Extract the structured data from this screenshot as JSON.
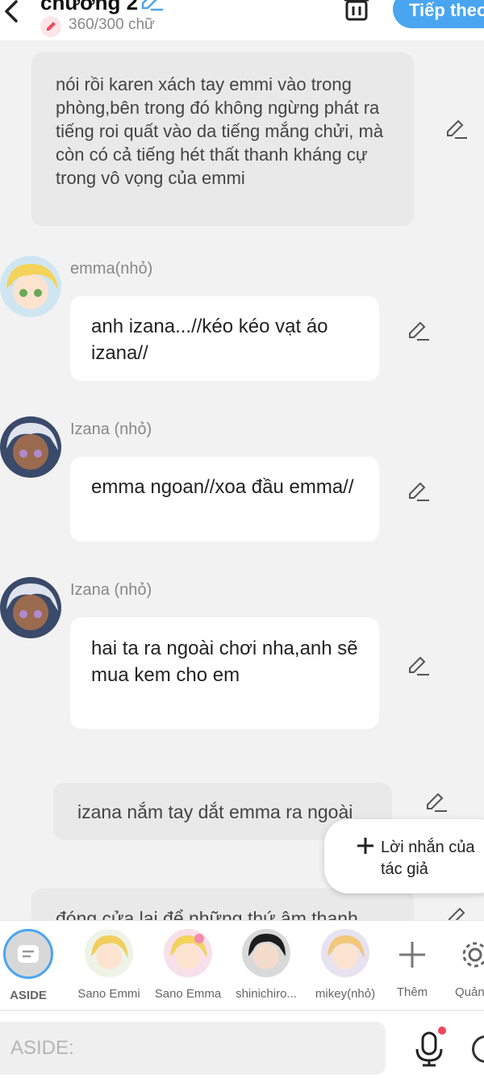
{
  "header": {
    "chapter_title": "chương 2",
    "word_count": "360/300 chữ",
    "next_label": "Tiếp theo"
  },
  "messages": [
    {
      "type": "narration",
      "text": "nói rồi karen xách tay emmi vào trong phòng,bên trong đó không ngừng phát ra tiếng roi quất vào da tiếng mắng chửi, mà còn có cả tiếng hét thất thanh kháng cự trong vô vọng của emmi"
    },
    {
      "type": "dialogue",
      "name": "emma(nhỏ)",
      "text": "anh izana...//kéo kéo vạt áo izana//"
    },
    {
      "type": "dialogue",
      "name": "Izana (nhỏ)",
      "text": "emma ngoan//xoa đầu emma//"
    },
    {
      "type": "dialogue",
      "name": "Izana (nhỏ)",
      "text": "hai ta ra ngoài chơi nha,anh sẽ mua kem cho em"
    },
    {
      "type": "narration",
      "text": "izana nắm tay dắt emma ra ngoài"
    },
    {
      "type": "narration",
      "text": "đóng cửa lại để những thứ âm thanh"
    }
  ],
  "author_note_button": "Lời nhắn của tác giả",
  "characters": [
    {
      "label": "ASIDE",
      "icon": "aside-icon",
      "active": true
    },
    {
      "label": "Sano Emmi",
      "icon": "avatar-blonde"
    },
    {
      "label": "Sano Emma",
      "icon": "avatar-blonde-bow"
    },
    {
      "label": "shinichiro...",
      "icon": "avatar-dark-hair"
    },
    {
      "label": "mikey(nhỏ)",
      "icon": "avatar-light-hair"
    },
    {
      "label": "Thêm",
      "icon": "plus-icon"
    },
    {
      "label": "Quản lý",
      "icon": "gear-icon"
    }
  ],
  "input": {
    "placeholder": "ASIDE:"
  },
  "colors": {
    "accent": "#4aa5f0",
    "background": "#f2f2f2",
    "narration_bg": "#e9e9e9",
    "record_dot": "#f0445a"
  }
}
